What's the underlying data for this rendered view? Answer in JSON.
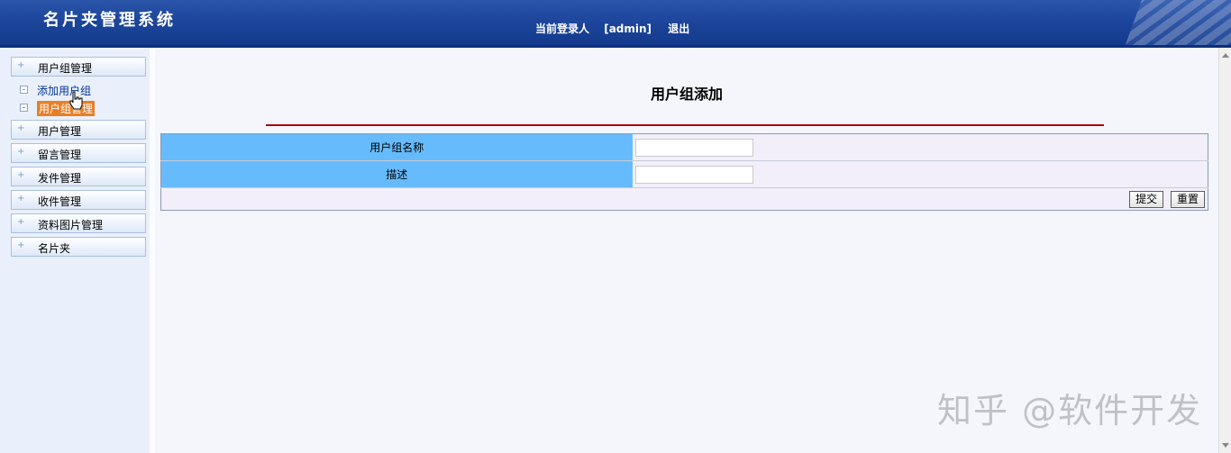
{
  "header": {
    "title": "名片夹管理系统",
    "login_label": "当前登录人",
    "user": "[admin]",
    "logout": "退出"
  },
  "sidebar": {
    "menus": [
      {
        "label": "用户组管理",
        "expanded": true,
        "children": [
          {
            "label": "添加用户组"
          },
          {
            "label": "用户组管理",
            "active": true
          }
        ]
      },
      {
        "label": "用户管理"
      },
      {
        "label": "留言管理"
      },
      {
        "label": "发件管理"
      },
      {
        "label": "收件管理"
      },
      {
        "label": "资料图片管理"
      },
      {
        "label": "名片夹"
      }
    ]
  },
  "main": {
    "title": "用户组添加",
    "fields": [
      {
        "label": "用户组名称",
        "value": ""
      },
      {
        "label": "描述",
        "value": ""
      }
    ],
    "submit": "提交",
    "reset": "重置"
  },
  "watermark": "知乎 @软件开发",
  "colors": {
    "header": "#1d469c",
    "label_bg": "#66bbfc",
    "rule": "#a40a0a",
    "active": "#e87f26"
  }
}
